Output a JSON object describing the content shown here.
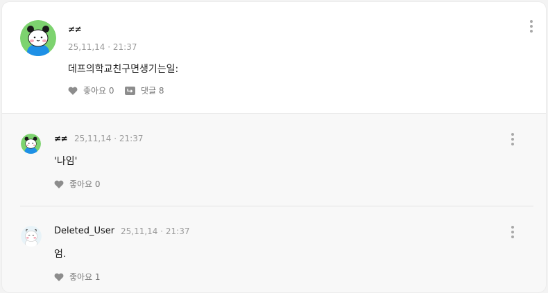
{
  "post": {
    "author": "≠≠",
    "timestamp": "25,11,14 · 21:37",
    "content": "데프의학교친구면생기는일:",
    "like_label": "좋아요 0",
    "comment_label": "댓글 8"
  },
  "comments": [
    {
      "author": "≠≠",
      "timestamp": "25,11,14 · 21:37",
      "content": "'나임'",
      "like_label": "좋아요 0"
    },
    {
      "author": "Deleted_User",
      "timestamp": "25,11,14 · 21:37",
      "content": "엄.",
      "like_label": "좋아요 1"
    }
  ],
  "icons": {
    "like": "heart-icon",
    "comment": "reply-arrow-icon",
    "more": "kebab-menu-icon"
  },
  "colors": {
    "avatar_green": "#7dd36f",
    "avatar_blue": "#1e90e6",
    "muted_text": "#9a9a9a"
  }
}
